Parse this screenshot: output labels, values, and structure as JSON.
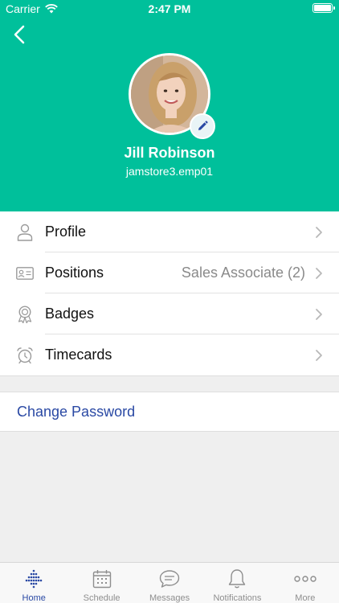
{
  "status_bar": {
    "carrier": "Carrier",
    "time": "2:47 PM"
  },
  "colors": {
    "header": "#00c09b",
    "accent": "#2a49a4",
    "chevron": "#b8b8b8"
  },
  "profile": {
    "name": "Jill Robinson",
    "username": "jamstore3.emp01"
  },
  "menu": [
    {
      "label": "Profile",
      "value": "",
      "icon": "person-icon"
    },
    {
      "label": "Positions",
      "value": "Sales Associate (2)",
      "icon": "id-card-icon"
    },
    {
      "label": "Badges",
      "value": "",
      "icon": "badge-icon"
    },
    {
      "label": "Timecards",
      "value": "",
      "icon": "alarm-clock-icon"
    }
  ],
  "change_password": {
    "label": "Change Password"
  },
  "tabs": [
    {
      "label": "Home",
      "icon": "home-dots-icon",
      "active": true
    },
    {
      "label": "Schedule",
      "icon": "calendar-icon",
      "active": false
    },
    {
      "label": "Messages",
      "icon": "chat-bubble-icon",
      "active": false
    },
    {
      "label": "Notifications",
      "icon": "bell-icon",
      "active": false
    },
    {
      "label": "More",
      "icon": "more-dots-icon",
      "active": false
    }
  ]
}
